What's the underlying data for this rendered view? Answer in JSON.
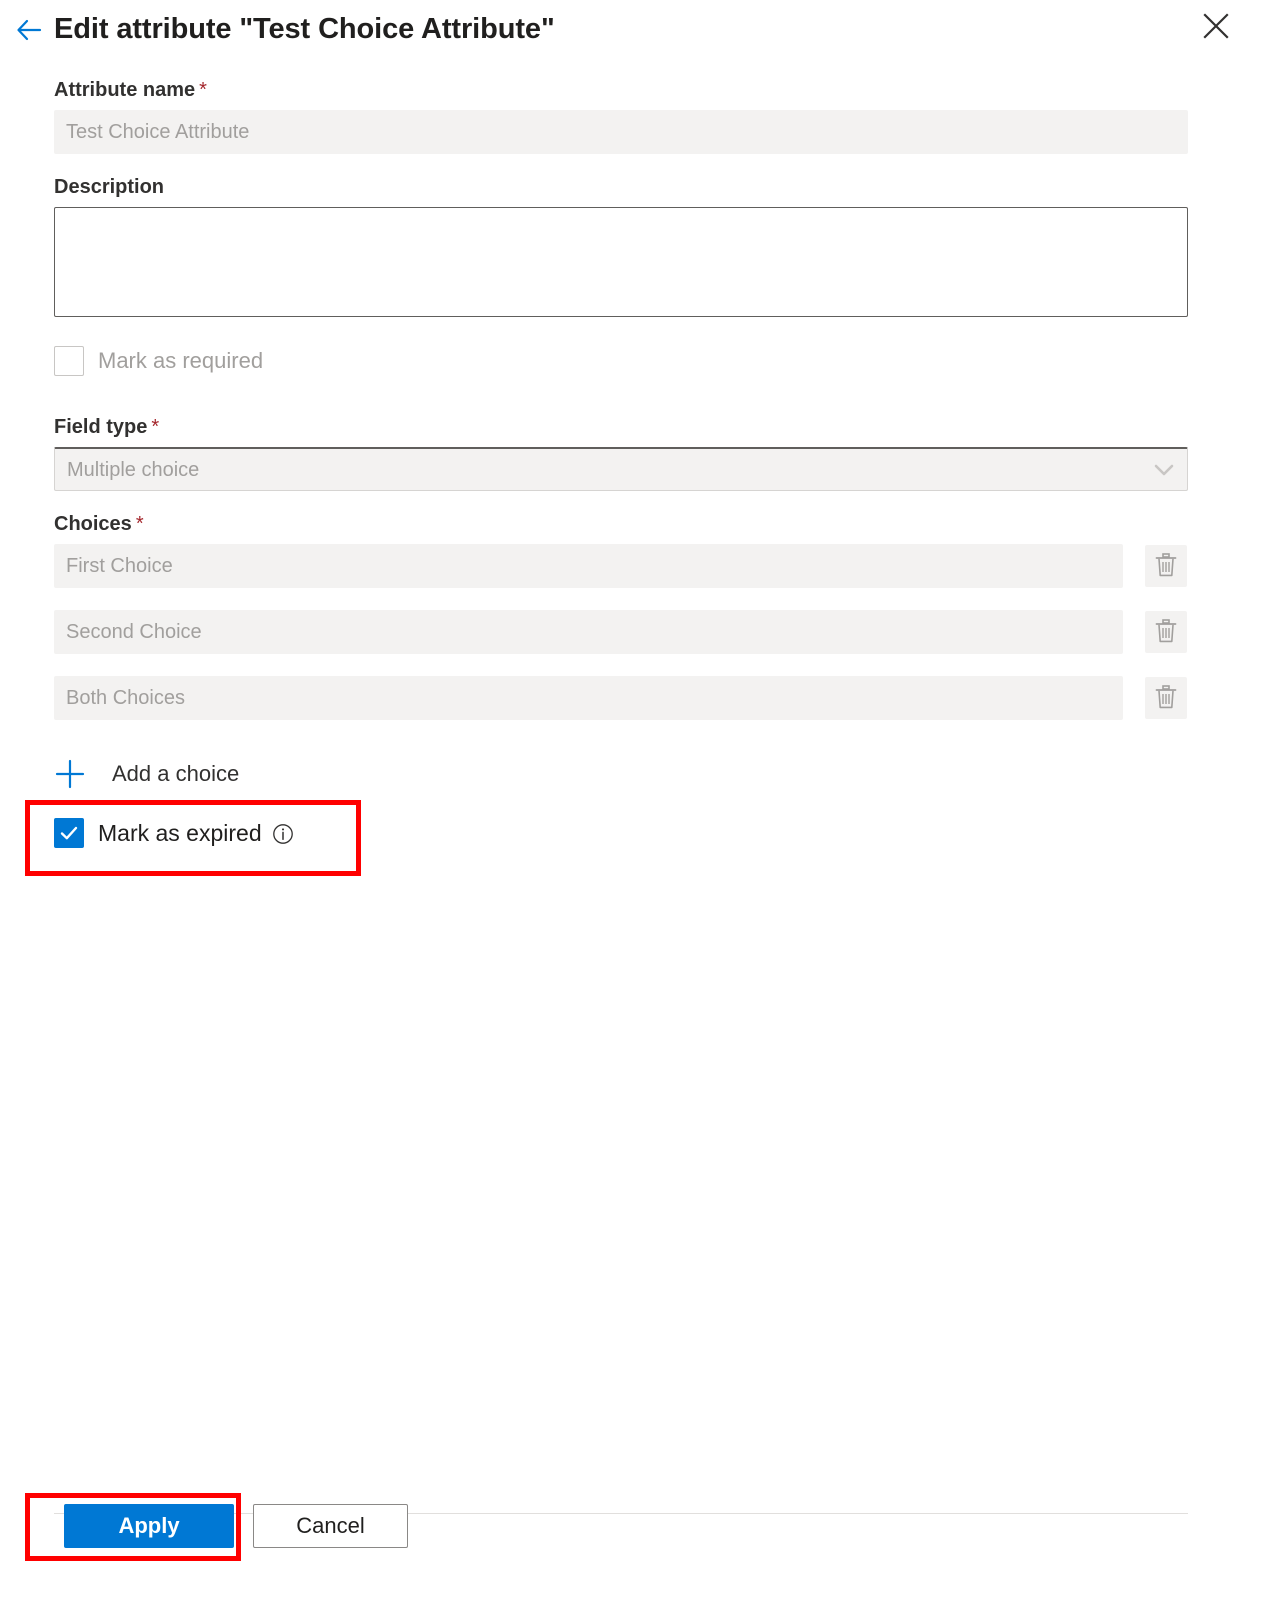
{
  "header": {
    "title": "Edit attribute \"Test Choice Attribute\"",
    "back_icon": "back-arrow-icon",
    "close_icon": "close-icon"
  },
  "form": {
    "attribute_name": {
      "label": "Attribute name",
      "required_marker": "*",
      "value": "",
      "placeholder": "Test Choice Attribute"
    },
    "description": {
      "label": "Description",
      "value": "",
      "placeholder": ""
    },
    "mark_as_required": {
      "label": "Mark as required",
      "checked": false,
      "disabled": true
    },
    "field_type": {
      "label": "Field type",
      "required_marker": "*",
      "selected": "Multiple choice",
      "chevron_icon": "chevron-down-icon"
    },
    "choices": {
      "label": "Choices",
      "required_marker": "*",
      "items": [
        {
          "value": "",
          "placeholder": "First Choice",
          "delete_icon": "trash-icon"
        },
        {
          "value": "",
          "placeholder": "Second Choice",
          "delete_icon": "trash-icon"
        },
        {
          "value": "",
          "placeholder": "Both Choices",
          "delete_icon": "trash-icon"
        }
      ],
      "add_label": "Add a choice",
      "add_icon": "plus-icon"
    },
    "mark_as_expired": {
      "label": "Mark as expired",
      "checked": true,
      "info_icon": "info-icon"
    }
  },
  "footer": {
    "apply_label": "Apply",
    "cancel_label": "Cancel"
  },
  "colors": {
    "accent": "#0078d4",
    "highlight": "#ff0000",
    "required_star": "#a4262c",
    "disabled_text": "#a19f9d",
    "field_background": "#f3f2f1"
  }
}
